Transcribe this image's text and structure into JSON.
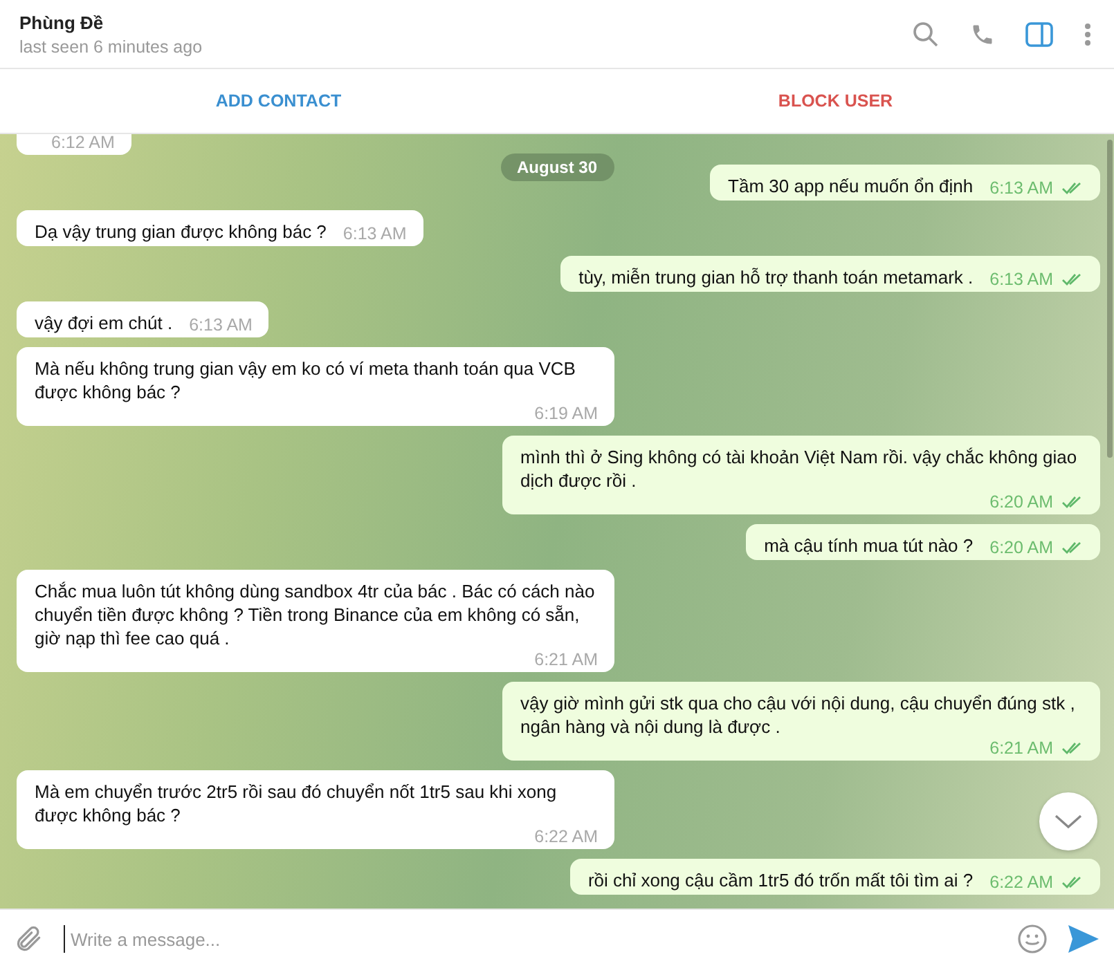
{
  "header": {
    "name": "Phùng Đề",
    "status": "last seen 6 minutes ago",
    "sidebar_toggle": {
      "on": true
    }
  },
  "actions": [
    {
      "label": "ADD CONTACT",
      "kind": "add"
    },
    {
      "label": "BLOCK USER",
      "kind": "block"
    }
  ],
  "date_pill": "August 30",
  "messages": [
    {
      "kind": "incoming",
      "time": "6:12 AM"
    },
    {
      "kind": "outgoing",
      "text": "Tầm 30  app nếu muốn ổn định",
      "time": "6:13 AM",
      "read": true
    },
    {
      "kind": "incoming",
      "text": "Dạ vậy trung gian được không bác ?",
      "time": "6:13 AM"
    },
    {
      "kind": "outgoing",
      "text": "tùy, miễn trung gian hỗ trợ thanh toán metamark .",
      "time": "6:13 AM",
      "read": true
    },
    {
      "kind": "incoming",
      "text": "vậy đợi em chút .",
      "time": "6:13 AM"
    },
    {
      "kind": "incoming",
      "text": "Mà nếu không trung gian vậy em ko có ví meta thanh toán qua VCB được không bác ?",
      "time": "6:19 AM"
    },
    {
      "kind": "outgoing",
      "text": "mình thì ở Sing không có tài khoản Việt Nam rồi. vậy chắc không giao dịch được rồi .",
      "time": "6:20 AM",
      "read": true
    },
    {
      "kind": "outgoing",
      "text": "mà cậu tính mua tút nào ?",
      "time": "6:20 AM",
      "read": true
    },
    {
      "kind": "incoming",
      "text": "Chắc mua luôn tút không dùng sandbox 4tr của bác . Bác có cách nào chuyển tiền được không ? Tiền trong Binance của em không có sẵn, giờ nạp thì fee cao quá .",
      "time": "6:21 AM"
    },
    {
      "kind": "outgoing",
      "text": "vậy giờ mình gửi stk qua cho cậu với nội dung, cậu chuyển đúng stk , ngân hàng và nội dung là được .",
      "time": "6:21 AM",
      "read": true
    },
    {
      "kind": "incoming",
      "text": "Mà em chuyển trước 2tr5 rồi sau đó chuyển nốt 1tr5 sau khi xong được không bác ?",
      "time": "6:22 AM"
    },
    {
      "kind": "outgoing",
      "text": "rồi chỉ xong cậu cầm 1tr5 đó trốn mất tôi tìm ai ?",
      "time": "6:22 AM",
      "read": true
    }
  ],
  "composer": {
    "placeholder": "Write a message..."
  }
}
